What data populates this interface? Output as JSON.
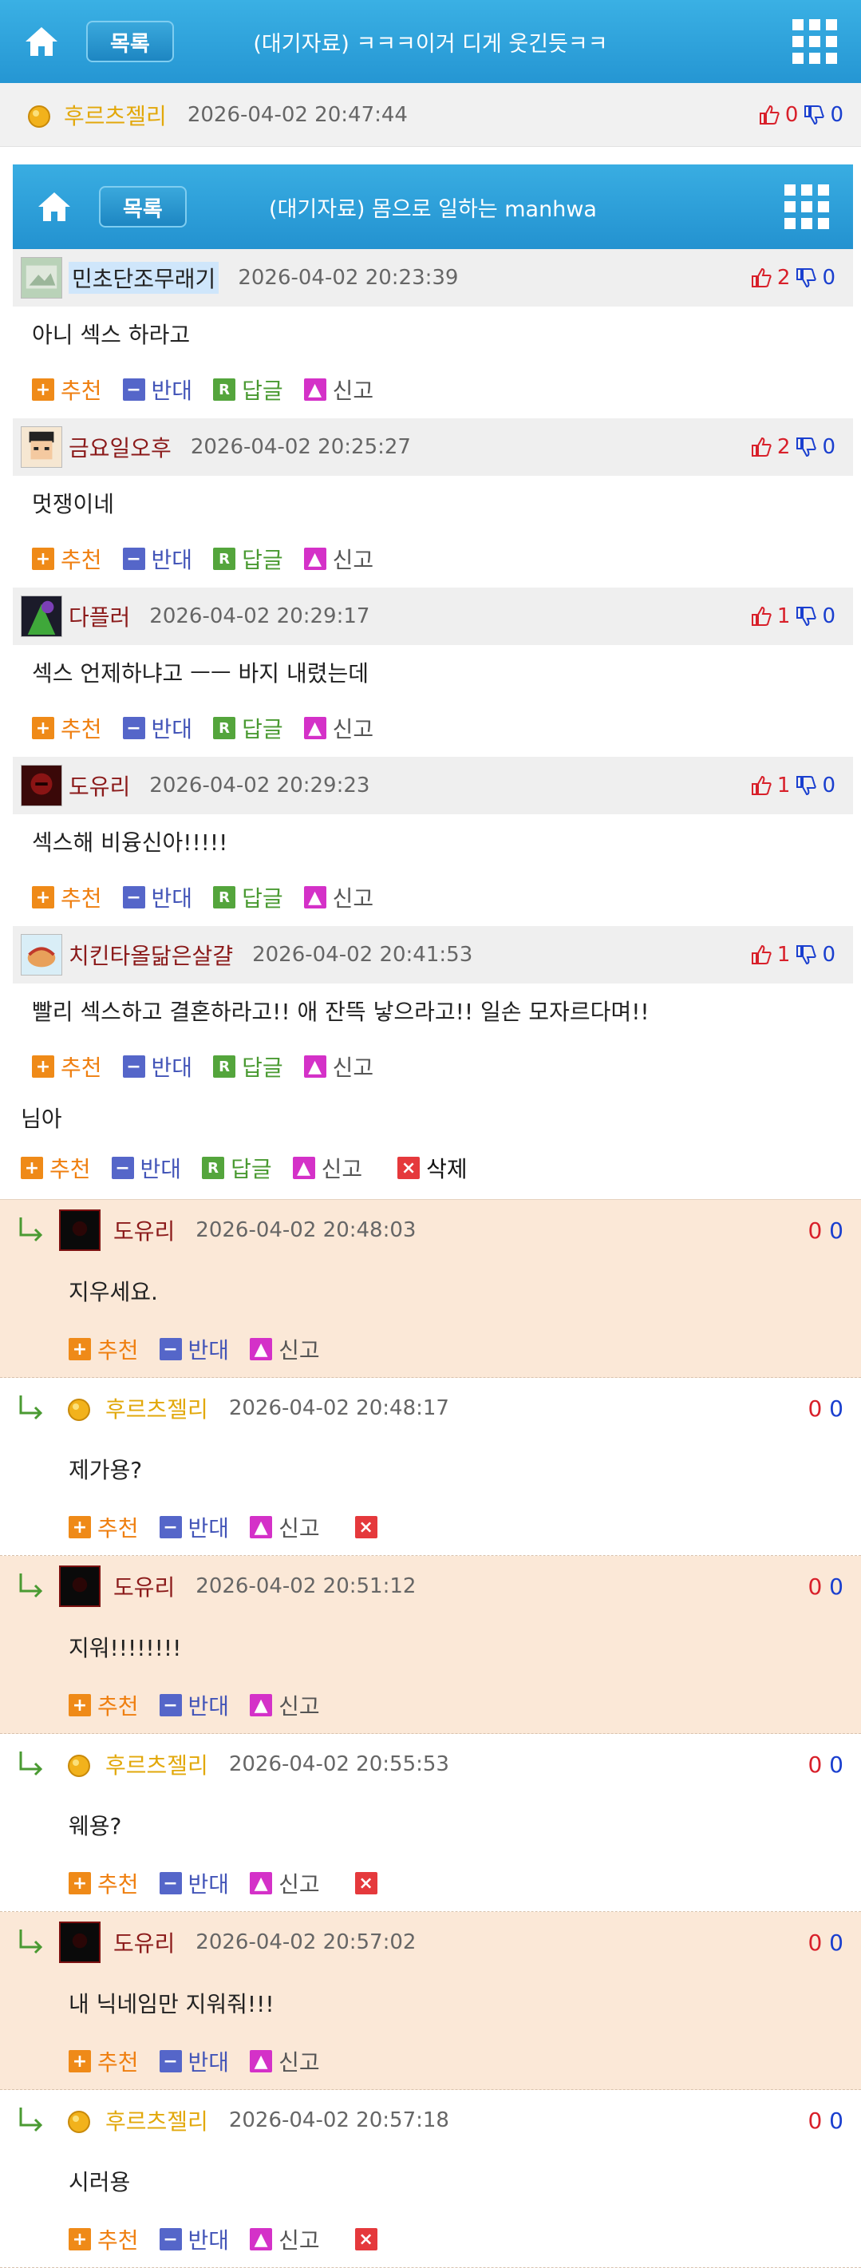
{
  "topbar": {
    "list_label": "목록",
    "title": "(대기자료) ㅋㅋㅋ이거 디게 웃긴듯ㅋㅋ"
  },
  "post": {
    "author": "후르츠젤리",
    "date": "2026-04-02 20:47:44",
    "up": "0",
    "down": "0"
  },
  "topbar2": {
    "list_label": "목록",
    "title": "(대기자료) 몸으로 일하는 manhwa"
  },
  "actions": {
    "recommend": "추천",
    "oppose": "반대",
    "reply": "답글",
    "report": "신고",
    "delete": "삭제"
  },
  "comments": [
    {
      "author": "민초단조무래기",
      "date": "2026-04-02 20:23:39",
      "up": "2",
      "down": "0",
      "text": "아니 섹스 하라고"
    },
    {
      "author": "금요일오후",
      "date": "2026-04-02 20:25:27",
      "up": "2",
      "down": "0",
      "text": "멋쟁이네"
    },
    {
      "author": "다플러",
      "date": "2026-04-02 20:29:17",
      "up": "1",
      "down": "0",
      "text": "섹스 언제하냐고 ㅡㅡ 바지 내렸는데"
    },
    {
      "author": "도유리",
      "date": "2026-04-02 20:29:23",
      "up": "1",
      "down": "0",
      "text": "섹스해 비융신아!!!!!"
    },
    {
      "author": "치킨타올닮은살걀",
      "date": "2026-04-02 20:41:53",
      "up": "1",
      "down": "0",
      "text": "빨리 섹스하고 결혼하라고!! 애 잔뜩 낳으라고!! 일손 모자르다며!!"
    }
  ],
  "loose_text": "님아",
  "replies": [
    {
      "author": "도유리",
      "date": "2026-04-02 20:48:03",
      "up": "0",
      "down": "0",
      "text": "지우세요."
    },
    {
      "author": "후르츠젤리",
      "date": "2026-04-02 20:48:17",
      "up": "0",
      "down": "0",
      "text": "제가용?"
    },
    {
      "author": "도유리",
      "date": "2026-04-02 20:51:12",
      "up": "0",
      "down": "0",
      "text": "지워!!!!!!!!"
    },
    {
      "author": "후르츠젤리",
      "date": "2026-04-02 20:55:53",
      "up": "0",
      "down": "0",
      "text": "웨용?"
    },
    {
      "author": "도유리",
      "date": "2026-04-02 20:57:02",
      "up": "0",
      "down": "0",
      "text": "내 닉네임만 지워줘!!!"
    },
    {
      "author": "후르츠젤리",
      "date": "2026-04-02 20:57:18",
      "up": "0",
      "down": "0",
      "text": "시러용"
    }
  ],
  "colors": {
    "accent": "#2596d3",
    "peach": "#fbe8d7",
    "up": "#d8202a",
    "down": "#1a3fcf"
  }
}
